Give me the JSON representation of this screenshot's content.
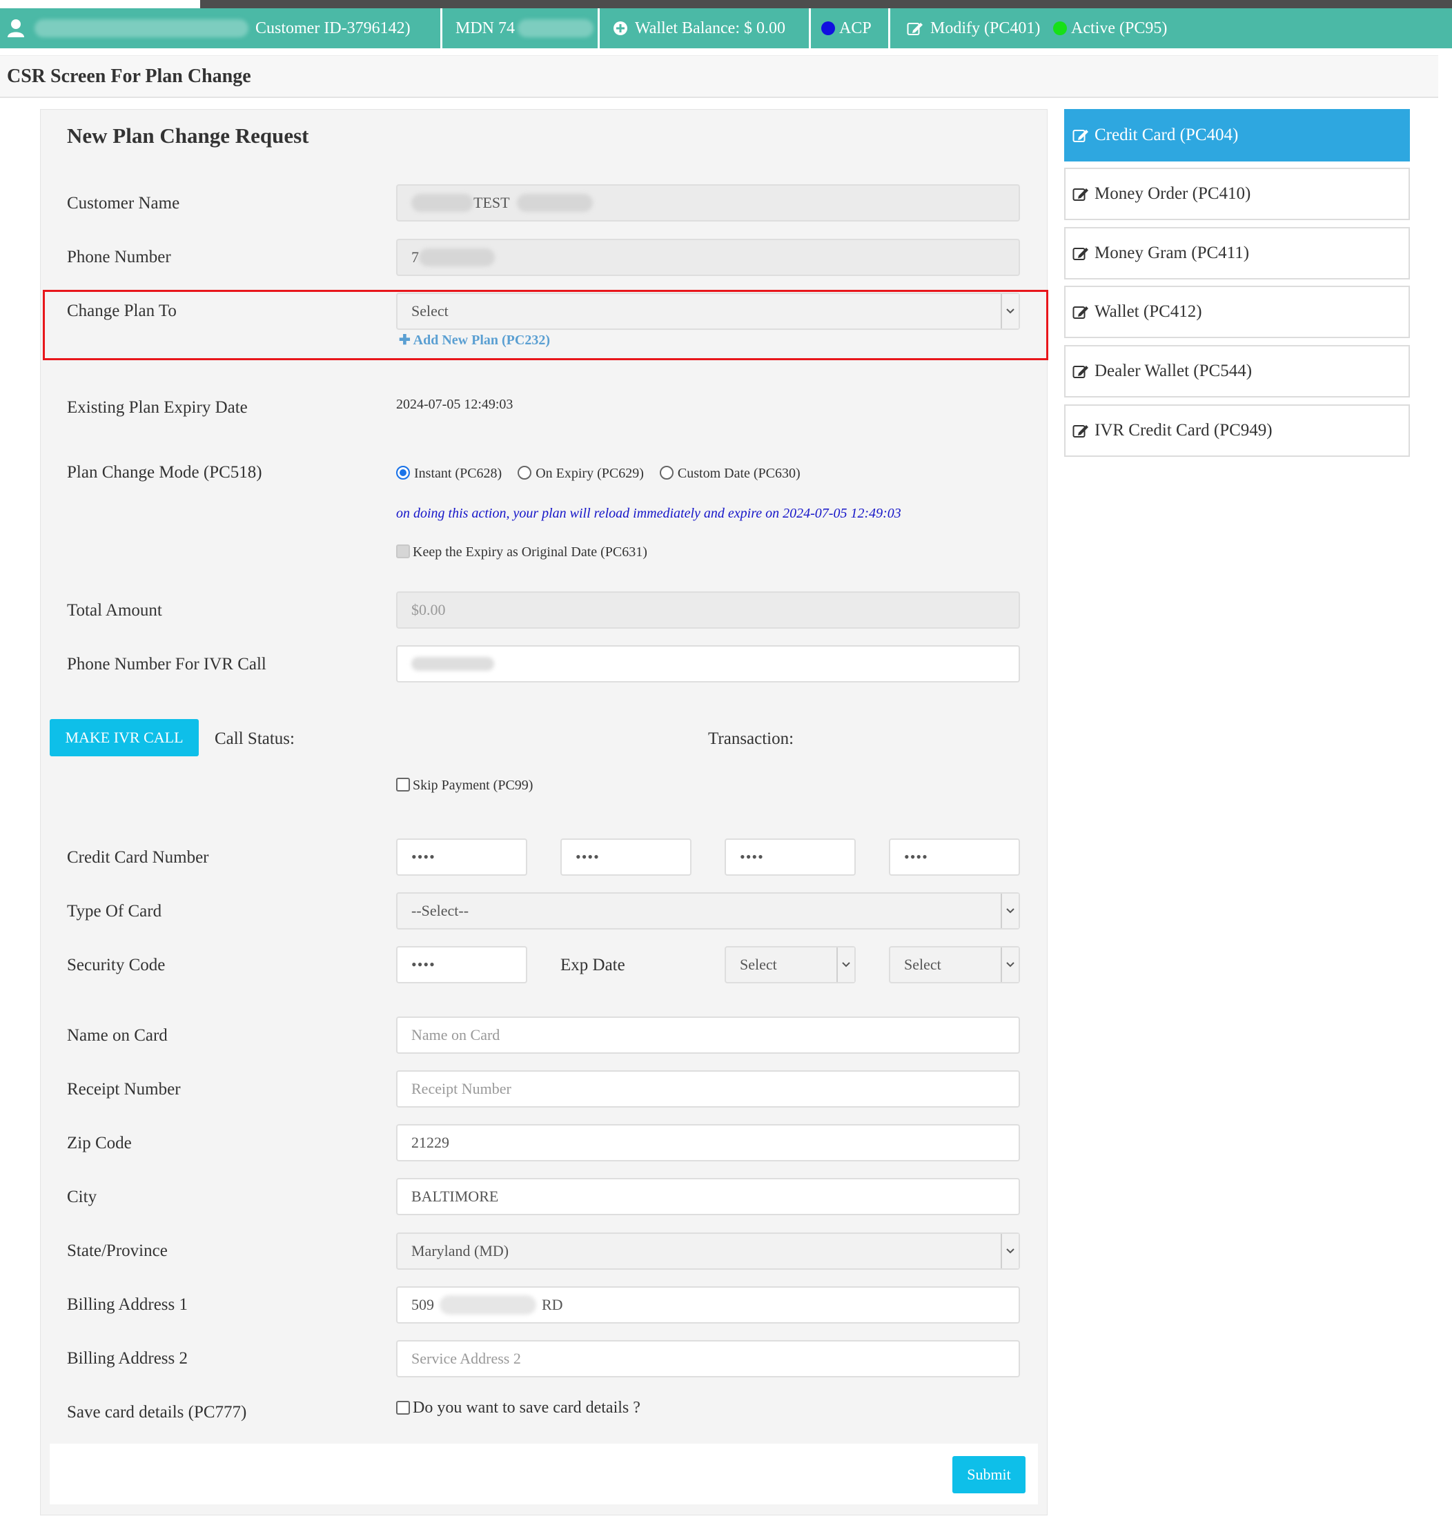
{
  "header": {
    "customer_id": "Customer ID-3796142)",
    "mdn": "MDN 74",
    "wallet_balance": "Wallet Balance: $ 0.00",
    "acp": "ACP",
    "modify": "Modify (PC401)",
    "status": "Active (PC95)",
    "colors": {
      "bar": "#4bb9a6",
      "acp_dot": "#1010e0",
      "active_dot": "#17e017"
    }
  },
  "page_title": "CSR Screen For Plan Change",
  "form": {
    "title": "New Plan Change Request",
    "customer_name": {
      "label": "Customer Name",
      "value": "TEST"
    },
    "phone_number": {
      "label": "Phone Number",
      "value": "7"
    },
    "change_plan": {
      "label": "Change Plan To",
      "value": "Select",
      "add_link": "Add New Plan (PC232)"
    },
    "expiry": {
      "label": "Existing Plan Expiry Date",
      "value": "2024-07-05 12:49:03"
    },
    "mode": {
      "label": "Plan Change Mode (PC518)",
      "options": [
        "Instant (PC628)",
        "On Expiry (PC629)",
        "Custom Date (PC630)"
      ],
      "selected": "Instant (PC628)",
      "note": "on doing this action, your plan will reload immediately and expire on 2024-07-05 12:49:03",
      "keep_expiry": "Keep the Expiry as Original Date (PC631)"
    },
    "total_amount": {
      "label": "Total Amount",
      "value": "$0.00"
    },
    "ivr_phone": {
      "label": "Phone Number For IVR Call",
      "value": ""
    },
    "ivr_button": "MAKE IVR CALL",
    "call_status": "Call Status:",
    "transaction": "Transaction:",
    "skip_payment": "Skip Payment (PC99)",
    "card_number": {
      "label": "Credit Card Number",
      "parts": [
        "••••",
        "••••",
        "••••",
        "••••"
      ]
    },
    "card_type": {
      "label": "Type Of Card",
      "value": "--Select--"
    },
    "security_code": {
      "label": "Security Code",
      "value": "••••"
    },
    "exp_date": {
      "label": "Exp Date",
      "month": "Select",
      "year": "Select"
    },
    "name_on_card": {
      "label": "Name on Card",
      "placeholder": "Name on Card"
    },
    "receipt": {
      "label": "Receipt Number",
      "placeholder": "Receipt Number"
    },
    "zip": {
      "label": "Zip Code",
      "value": "21229"
    },
    "city": {
      "label": "City",
      "value": "BALTIMORE"
    },
    "state": {
      "label": "State/Province",
      "value": "Maryland (MD)"
    },
    "billing1": {
      "label": "Billing Address 1",
      "value_start": "509",
      "value_end": "RD"
    },
    "billing2": {
      "label": "Billing Address 2",
      "placeholder": "Service Address 2"
    },
    "save_card": {
      "label": "Save card details (PC777)",
      "question": "Do you want to save card details ?"
    },
    "submit": "Submit"
  },
  "side_menu": [
    {
      "label": "Credit Card (PC404)",
      "active": true
    },
    {
      "label": "Money Order (PC410)",
      "active": false
    },
    {
      "label": "Money Gram (PC411)",
      "active": false
    },
    {
      "label": "Wallet (PC412)",
      "active": false
    },
    {
      "label": "Dealer Wallet (PC544)",
      "active": false
    },
    {
      "label": "IVR Credit Card (PC949)",
      "active": false
    }
  ]
}
